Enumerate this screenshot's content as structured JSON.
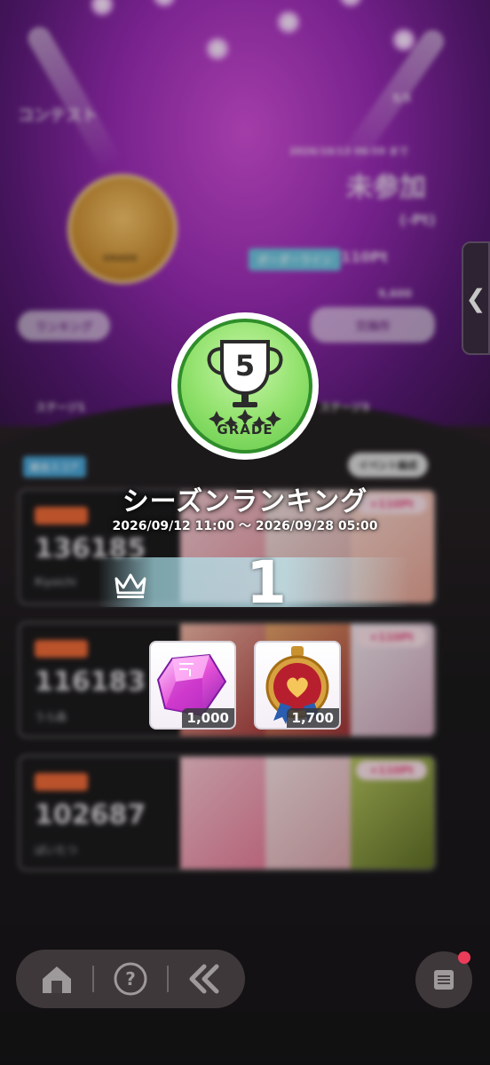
{
  "background": {
    "contest_label": "コンテスト",
    "stage_count": "5/5",
    "deadline": "2026/10/13 06:59 まで",
    "status": "未参加",
    "points_paren": "(-Pt)",
    "threshold_label": "ボーダーライン",
    "threshold_value": "110Pt",
    "currency_value": "9,600",
    "ranking_button": "ランキング",
    "exchange_button": "交換所",
    "trophy_caption": "GRADE",
    "stage_label_1": "ステージ1",
    "stage_label_2": "ステージ3",
    "tab_label_1": "総合スコア",
    "tab_label_2": "イベント編成",
    "rows": [
      {
        "tag": "総合スコア",
        "score": "136185",
        "name": "Riyoichi",
        "plus": "+110Pt"
      },
      {
        "tag": "総合スコア",
        "score": "116183",
        "name": "うら森",
        "plus": "+110Pt"
      },
      {
        "tag": "総合スコア",
        "score": "102687",
        "name": "ぱいたつ",
        "plus": "+110Pt"
      }
    ],
    "side_tab_icon": "chevron-left-icon"
  },
  "modal": {
    "grade_number": "5",
    "grade_label": "GRADE",
    "season_title": "シーズンランキング",
    "season_period": "2026/09/12 11:00 ～ 2026/09/28 05:00",
    "rank": "1",
    "rank_icon": "crown-icon",
    "rewards": [
      {
        "icon": "gem-icon",
        "quantity": "1,000"
      },
      {
        "icon": "medal-icon",
        "quantity": "1,700"
      }
    ]
  },
  "bottom_nav": {
    "home_icon": "home-icon",
    "help_icon": "help-icon",
    "back_icon": "double-chevron-left-icon",
    "menu_icon": "menu-icon"
  },
  "colors": {
    "grade_green": "#62c94a",
    "stage_purple": "#9a2cb6",
    "tag_orange": "#ef6a38",
    "badge_red": "#ec3c5a"
  }
}
